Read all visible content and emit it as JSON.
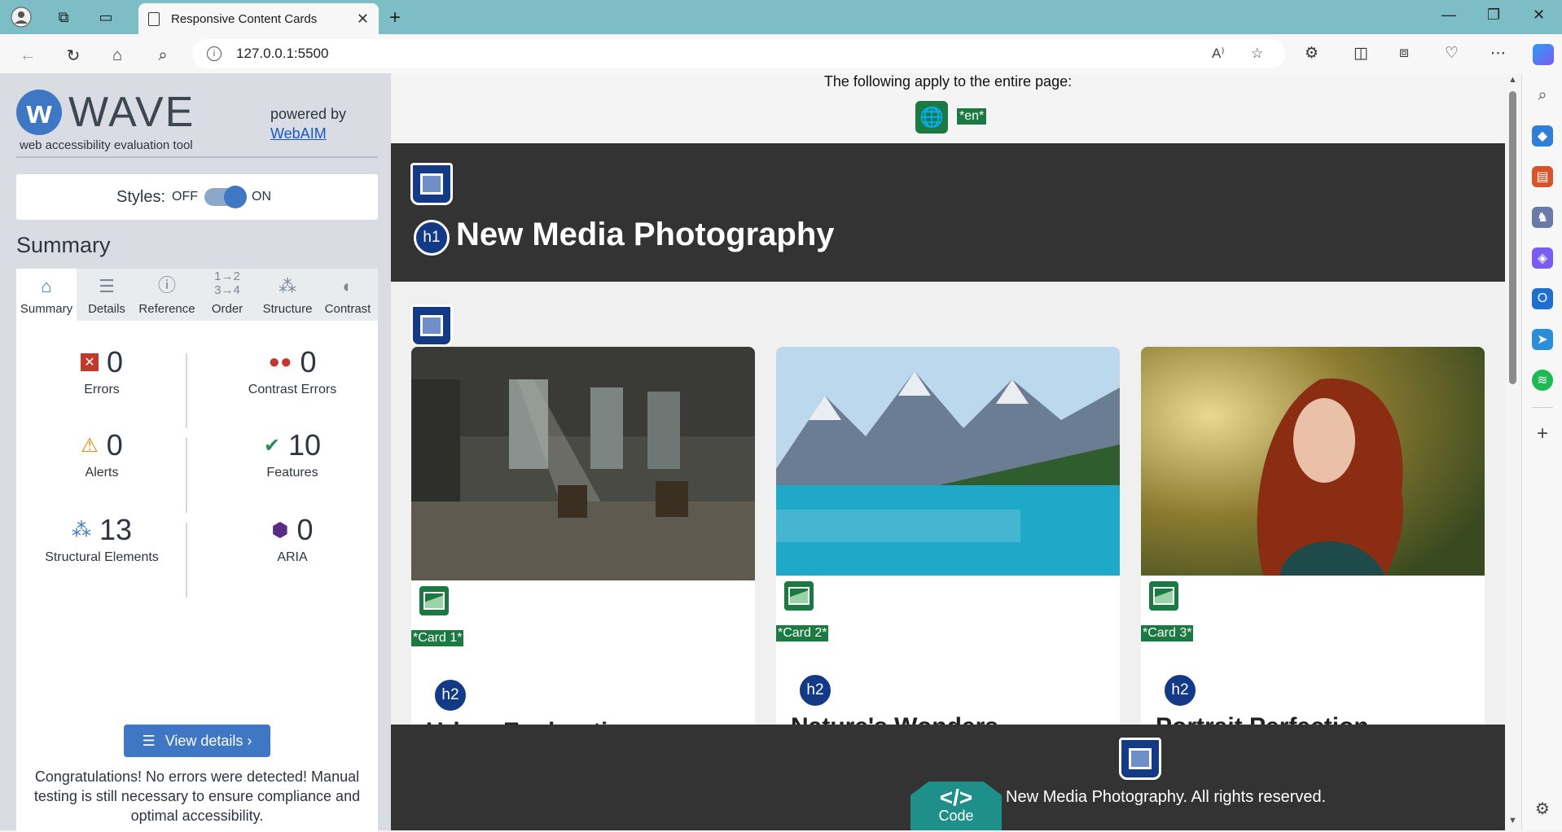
{
  "browser": {
    "tab_title": "Responsive Content Cards",
    "url": "127.0.0.1:5500",
    "new_tab": "+",
    "close_tab": "✕"
  },
  "wave": {
    "logo_word": "WAVE",
    "subtitle": "web accessibility evaluation tool",
    "powered_by": "powered by",
    "webaim_link": "WebAIM",
    "styles_label": "Styles:",
    "styles_off": "OFF",
    "styles_on": "ON",
    "summary_title": "Summary",
    "tabs": [
      {
        "label": "Summary",
        "icon": "home-icon"
      },
      {
        "label": "Details",
        "icon": "list-icon"
      },
      {
        "label": "Reference",
        "icon": "info-icon"
      },
      {
        "label": "Order",
        "icon": "order-icon"
      },
      {
        "label": "Structure",
        "icon": "structure-icon"
      },
      {
        "label": "Contrast",
        "icon": "contrast-icon"
      }
    ],
    "stats": {
      "errors": {
        "value": "0",
        "label": "Errors"
      },
      "contrast_errors": {
        "value": "0",
        "label": "Contrast Errors"
      },
      "alerts": {
        "value": "0",
        "label": "Alerts"
      },
      "features": {
        "value": "10",
        "label": "Features"
      },
      "structural": {
        "value": "13",
        "label": "Structural Elements"
      },
      "aria": {
        "value": "0",
        "label": "ARIA"
      }
    },
    "view_details": "View details ›",
    "congrats": "Congratulations! No errors were detected! Manual testing is still necessary to ensure compliance and optimal accessibility."
  },
  "page": {
    "apply_note": "The following apply to the entire page:",
    "lang_tag": "*en*",
    "h1_badge": "h1",
    "title": "New Media Photography",
    "cards": [
      {
        "tag": "*Card 1*",
        "h2": "h2",
        "title": "Urban Exploration"
      },
      {
        "tag": "*Card 2*",
        "h2": "h2",
        "title": "Nature's Wonders"
      },
      {
        "tag": "*Card 3*",
        "h2": "h2",
        "title": "Portrait Perfection"
      }
    ],
    "footer": "New Media Photography. All rights reserved.",
    "code_symbol": "</>",
    "code_label": "Code"
  },
  "colors": {
    "wave_blue": "#3f77c4",
    "feature_green": "#1a7a42",
    "landmark_navy": "#123a86",
    "dark_band": "#333333"
  }
}
